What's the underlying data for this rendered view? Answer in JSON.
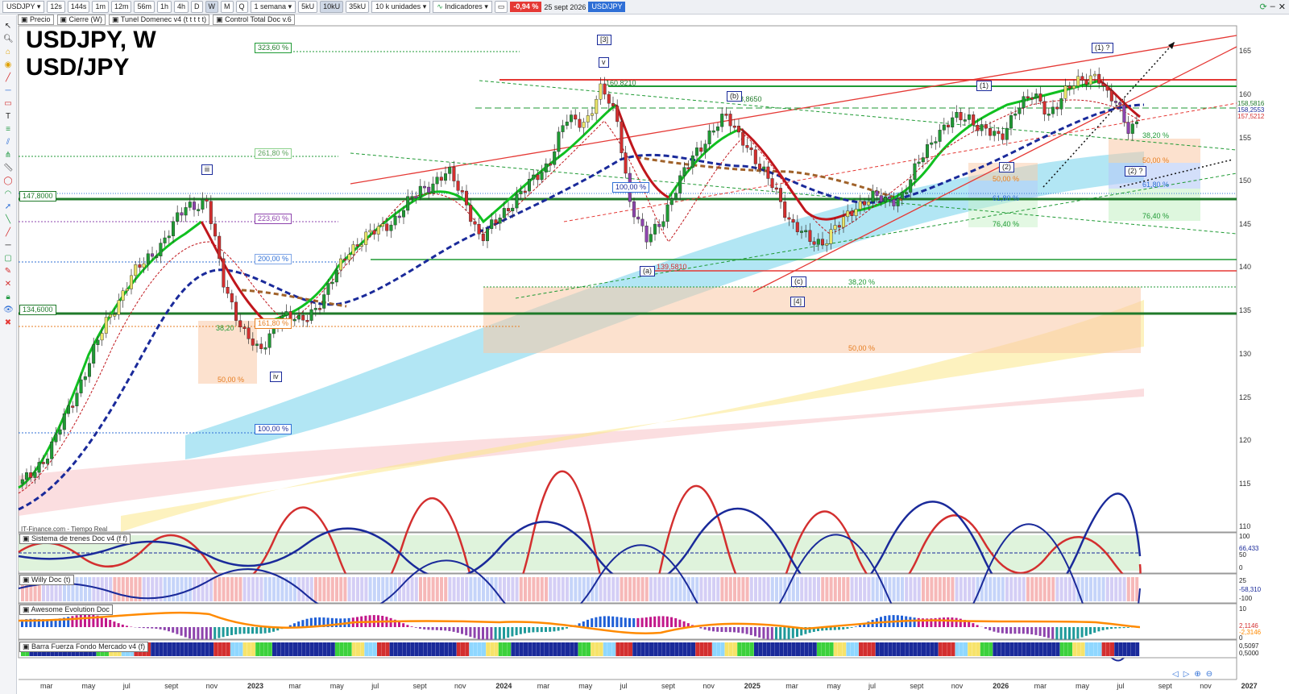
{
  "toolbar": {
    "symbol": "USDJPY",
    "periods": [
      "12s",
      "144s",
      "1m",
      "12m",
      "56m",
      "1h",
      "4h",
      "D",
      "W",
      "M",
      "Q"
    ],
    "active_period": "W",
    "interval": "1 semana",
    "units": [
      "5kU",
      "10kU",
      "35kU"
    ],
    "active_unit": "10kU",
    "quantity": "10 k unidades",
    "indicators_label": "Indicadores",
    "change": "-0,94 %",
    "date": "25 sept 2026",
    "pair_tag": "USD/JPY"
  },
  "legend": {
    "price": "Precio",
    "close": "Cierre (W)",
    "tunnel": "Tunel Domenec v4 (t t t t t)",
    "control": "Control Total Doc v.6"
  },
  "chart_title": {
    "line1": "USDJPY, W",
    "line2": "USD/JPY"
  },
  "credit": "IT-Finance.com - Tiempo Real",
  "price_axis": {
    "ticks": [
      "165",
      "160",
      "155",
      "150",
      "145",
      "140",
      "135",
      "130",
      "125",
      "120",
      "115",
      "110"
    ],
    "last_prices": [
      "158,5816",
      "158,2553",
      "157,5212"
    ]
  },
  "time_axis": [
    "mar",
    "may",
    "jul",
    "sept",
    "nov",
    "2023",
    "mar",
    "may",
    "jul",
    "sept",
    "nov",
    "2024",
    "mar",
    "may",
    "jul",
    "sept",
    "nov",
    "2025",
    "mar",
    "may",
    "jul",
    "sept",
    "nov",
    "2026",
    "mar",
    "may",
    "jul",
    "sept",
    "nov",
    "2027"
  ],
  "levels": {
    "l147": "147,8000",
    "l134": "134,6000"
  },
  "fib_labels": {
    "f323": "323,60 %",
    "f261": "261,80 %",
    "f223": "223,60 %",
    "f200": "200,00 %",
    "f161": "161,80 %",
    "f38a": "38,20",
    "f50a": "50,00 %",
    "f100a": "100,00 %",
    "f100b": "100,00 %",
    "f38b": "38,20 %",
    "f50b": "50,00 %",
    "f50c": "50,00 %",
    "f61a": "61,80 %",
    "f76a": "76,40 %",
    "f38c": "38,20 %",
    "f50d": "50,00 %",
    "f61b": "61,80 %",
    "f76b": "76,40 %"
  },
  "price_labels": {
    "p1": "160,8210",
    "p2": "158,8650",
    "p3": "139,5810"
  },
  "waves": {
    "w3": "[3]",
    "wv": "v",
    "wiii": "iii",
    "wiv": "iv",
    "wa": "(a)",
    "wc": "(c)",
    "w4": "[4]",
    "wb": "(b)",
    "w1": "(1)",
    "w1q": "(1) ?",
    "w2": "(2)",
    "w2q": "(2) ?"
  },
  "indicators": [
    {
      "name": "Sistema de trenes Doc v4 (f f)",
      "values": [
        "100",
        "66,433",
        "50",
        "0"
      ]
    },
    {
      "name": "Willy Doc (t)",
      "values": [
        "25",
        "-58,310",
        "-100"
      ]
    },
    {
      "name": "Awesome Evolution Doc",
      "values": [
        "10",
        "2,1146",
        "-2,3146",
        "0"
      ]
    },
    {
      "name": "Barra Fuerza Fondo Mercado v4 (f)",
      "values": [
        "0,5097",
        "0,5000"
      ]
    }
  ],
  "colors": {
    "bull": "#1f9a34",
    "bear": "#d32f2f",
    "cyan_cloud": "#7fd6ec",
    "yellow_cloud": "#fbe88a",
    "pink_cloud": "#f7c2c7"
  }
}
